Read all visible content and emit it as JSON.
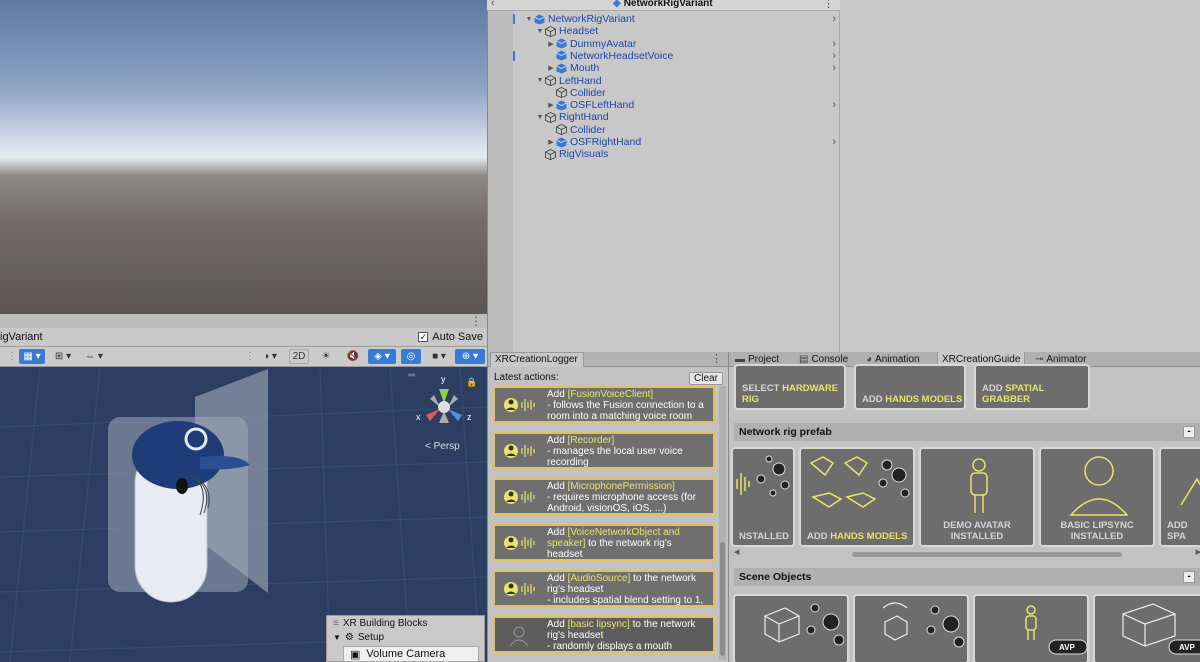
{
  "game_view": {
    "menu_icon": "kebab-icon"
  },
  "scene_bar": {
    "title": "igVariant",
    "autosave_label": "Auto Save",
    "autosave_checked": true
  },
  "scene_toolbar": {
    "mode_2d": "2D",
    "persp_label": "Persp"
  },
  "gizmo": {
    "x": "x",
    "y": "y",
    "z": "z"
  },
  "xr_blocks": {
    "title": "XR Building Blocks",
    "setup": "Setup",
    "item": "Volume Camera"
  },
  "hierarchy": {
    "header_title": "NetworkRigVariant",
    "items": [
      {
        "label": "NetworkRigVariant",
        "depth": 0,
        "expand": "down",
        "prefab": true,
        "chevron": true
      },
      {
        "label": "Headset",
        "depth": 1,
        "expand": "down",
        "prefab": false,
        "chevron": false
      },
      {
        "label": "DummyAvatar",
        "depth": 2,
        "expand": "right",
        "prefab": true,
        "chevron": true
      },
      {
        "label": "NetworkHeadsetVoice",
        "depth": 2,
        "expand": "none",
        "prefab": true,
        "chevron": true
      },
      {
        "label": "Mouth",
        "depth": 2,
        "expand": "right",
        "prefab": true,
        "chevron": true
      },
      {
        "label": "LeftHand",
        "depth": 1,
        "expand": "down",
        "prefab": false,
        "chevron": false
      },
      {
        "label": "Collider",
        "depth": 2,
        "expand": "none",
        "prefab": false,
        "chevron": false
      },
      {
        "label": "OSFLeftHand",
        "depth": 2,
        "expand": "right",
        "prefab": true,
        "chevron": true
      },
      {
        "label": "RightHand",
        "depth": 1,
        "expand": "down",
        "prefab": false,
        "chevron": false
      },
      {
        "label": "Collider",
        "depth": 2,
        "expand": "none",
        "prefab": false,
        "chevron": false
      },
      {
        "label": "OSFRightHand",
        "depth": 2,
        "expand": "right",
        "prefab": true,
        "chevron": true
      },
      {
        "label": "RigVisuals",
        "depth": 1,
        "expand": "none",
        "prefab": false,
        "chevron": false
      }
    ]
  },
  "logger": {
    "tab": "XRCreationLogger",
    "latest": "Latest actions:",
    "clear": "Clear",
    "items": [
      {
        "pre": "Add ",
        "hl": "[FusionVoiceClient]",
        "post": "",
        "lines": [
          "- follows the Fusion connection to a",
          "room into a matching voice room"
        ]
      },
      {
        "pre": "Add ",
        "hl": "[Recorder]",
        "post": "",
        "lines": [
          "- manages the local user voice",
          "recording"
        ]
      },
      {
        "pre": "Add ",
        "hl": "[MicrophonePermission]",
        "post": "",
        "lines": [
          "- requires microphone access (for",
          "Android, visionOS, iOS, ...)"
        ]
      },
      {
        "pre": "Add ",
        "hl": "[VoiceNetworkObject and speaker]",
        "post": " to the network rig's",
        "lines": [
          "headset"
        ]
      },
      {
        "pre": "Add ",
        "hl": "[AudioSource]",
        "post": " to the network",
        "lines": [
          "rig's headset",
          "- includes spatial blend setting to 1,"
        ]
      },
      {
        "pre": "Add ",
        "hl": "[basic lipsync]",
        "post": " to the network",
        "lines": [
          "rig's headset",
          "- randomly displays a mouth"
        ]
      }
    ]
  },
  "tabs": [
    {
      "label": "Project",
      "icon": "folder-icon"
    },
    {
      "label": "Console",
      "icon": "console-icon"
    },
    {
      "label": "Animation",
      "icon": "animation-icon"
    },
    {
      "label": "XRCreationGuide",
      "icon": ""
    },
    {
      "label": "Animator",
      "icon": "animator-icon"
    }
  ],
  "guide": {
    "top_cards": [
      {
        "pre": "SELECT ",
        "hl": "HARDWARE RIG"
      },
      {
        "pre": "ADD ",
        "hl": "HANDS MODELS"
      },
      {
        "pre": "ADD ",
        "hl": "SPATIAL GRABBER"
      }
    ],
    "network_title": "Network rig prefab",
    "network_cards": [
      {
        "line1": "NSTALLED",
        "line2": ""
      },
      {
        "line1": "ADD HANDS MODELS",
        "line2": ""
      },
      {
        "line1": "DEMO AVATAR",
        "line2": "INSTALLED"
      },
      {
        "line1": "BASIC LIPSYNC",
        "line2": "INSTALLED"
      },
      {
        "line1": "ADD SPA",
        "line2": ""
      }
    ],
    "scene_title": "Scene Objects",
    "avp_badge": "AVP",
    "collapse": "-"
  }
}
